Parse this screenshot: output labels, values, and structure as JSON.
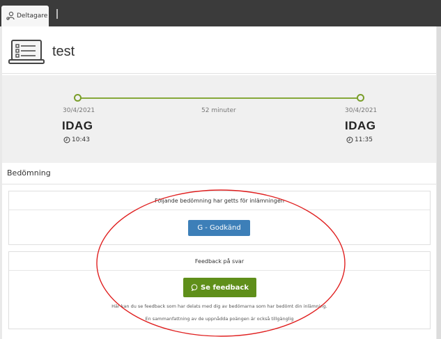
{
  "tab": {
    "label": "Deltagare"
  },
  "header": {
    "title": "test"
  },
  "timeline": {
    "start_date": "30/4/2021",
    "end_date": "30/4/2021",
    "duration": "52 minuter",
    "start_day": "IDAG",
    "end_day": "IDAG",
    "start_time": "10:43",
    "end_time": "11:35",
    "accent_color": "#86a83a"
  },
  "assessment": {
    "section_title": "Bedömning",
    "grade_heading": "Följande bedömning har getts för inlämningen",
    "grade_button": "G - Godkänd",
    "feedback_heading": "Feedback på svar",
    "feedback_button": "Se feedback",
    "note_line1": "Här kan du se feedback som har delats med dig av bedömarna som har bedömt din inlämning.",
    "note_line2": "En sammanfattning av de uppnådda poängen är också tillgänglig",
    "grade_color": "#3d7fb8",
    "feedback_color": "#5f8f1a"
  },
  "annotation": {
    "circle_color": "#e02020"
  }
}
